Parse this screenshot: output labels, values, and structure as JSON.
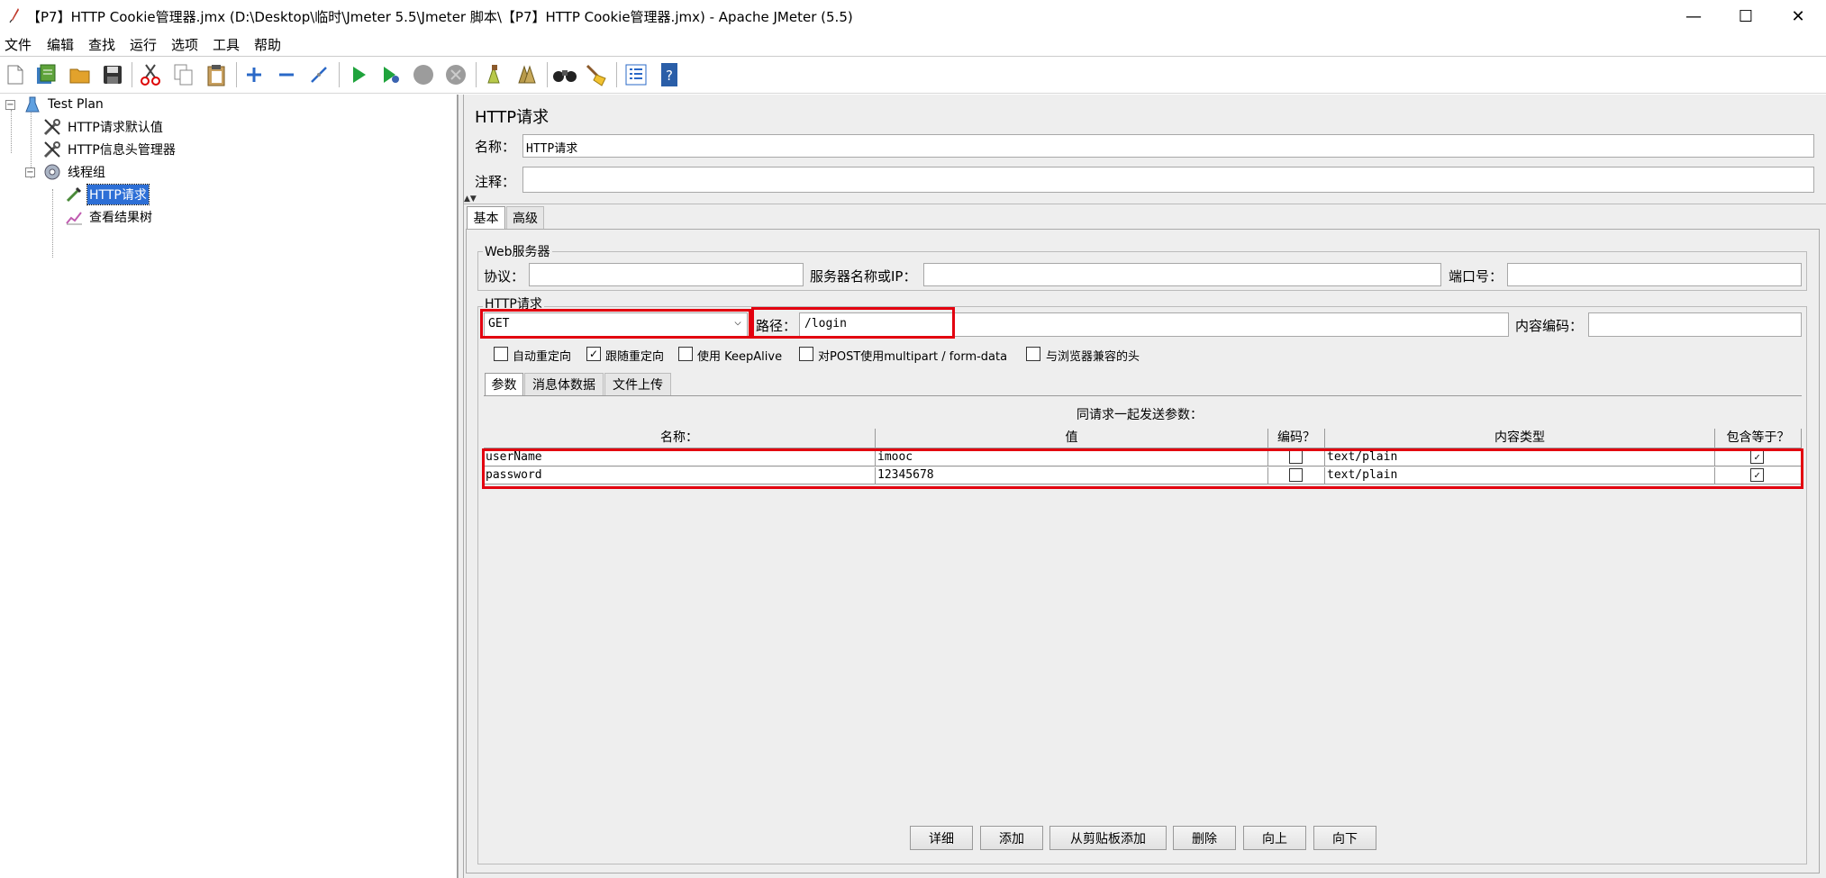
{
  "window": {
    "title": "【P7】HTTP Cookie管理器.jmx (D:\\Desktop\\临时\\Jmeter 5.5\\Jmeter 脚本\\【P7】HTTP Cookie管理器.jmx) - Apache JMeter (5.5)",
    "minimize": "—",
    "maximize": "☐",
    "close": "✕"
  },
  "menu": [
    "文件",
    "编辑",
    "查找",
    "运行",
    "选项",
    "工具",
    "帮助"
  ],
  "toolbar": [
    "new-icon",
    "templates-icon",
    "open-icon",
    "save-icon",
    "cut-icon",
    "copy-icon",
    "paste-icon",
    "expand-icon",
    "collapse-icon",
    "toggle-icon",
    "start-icon",
    "start-no-pause-icon",
    "stop-icon",
    "shutdown-icon",
    "clear-icon",
    "clear-all-icon",
    "search-icon",
    "reset-search-icon",
    "function-helper-icon",
    "help-icon"
  ],
  "tree": {
    "root": "Test Plan",
    "items": [
      "HTTP请求默认值",
      "HTTP信息头管理器",
      "线程组",
      "HTTP请求",
      "查看结果树"
    ]
  },
  "panel": {
    "title": "HTTP请求",
    "name_label": "名称：",
    "name_value": "HTTP请求",
    "comment_label": "注释：",
    "comment_value": "",
    "tabs": [
      "基本",
      "高级"
    ],
    "web_server": {
      "legend": "Web服务器",
      "protocol_label": "协议：",
      "protocol_value": "",
      "server_label": "服务器名称或IP：",
      "server_value": "",
      "port_label": "端口号：",
      "port_value": ""
    },
    "http_request": {
      "legend": "HTTP请求",
      "method": "GET",
      "path_label": "路径：",
      "path_value": "/login",
      "encoding_label": "内容编码：",
      "encoding_value": "",
      "checkboxes": [
        {
          "label": "自动重定向",
          "checked": false
        },
        {
          "label": "跟随重定向",
          "checked": true
        },
        {
          "label": "使用 KeepAlive",
          "checked": false
        },
        {
          "label": "对POST使用multipart / form-data",
          "checked": false
        },
        {
          "label": "与浏览器兼容的头",
          "checked": false
        }
      ]
    },
    "subtabs": [
      "参数",
      "消息体数据",
      "文件上传"
    ],
    "params_caption": "同请求一起发送参数：",
    "columns": [
      "名称：",
      "值",
      "编码？",
      "内容类型",
      "包含等于？"
    ],
    "rows": [
      {
        "name": "userName",
        "value": "imooc",
        "encode": false,
        "content_type": "text/plain",
        "include_equals": true
      },
      {
        "name": "password",
        "value": "12345678",
        "encode": false,
        "content_type": "text/plain",
        "include_equals": true
      }
    ],
    "buttons": [
      "详细",
      "添加",
      "从剪贴板添加",
      "删除",
      "向上",
      "向下"
    ]
  },
  "colors": {
    "highlight": "#e3000f",
    "selection": "#2d6fd6"
  }
}
